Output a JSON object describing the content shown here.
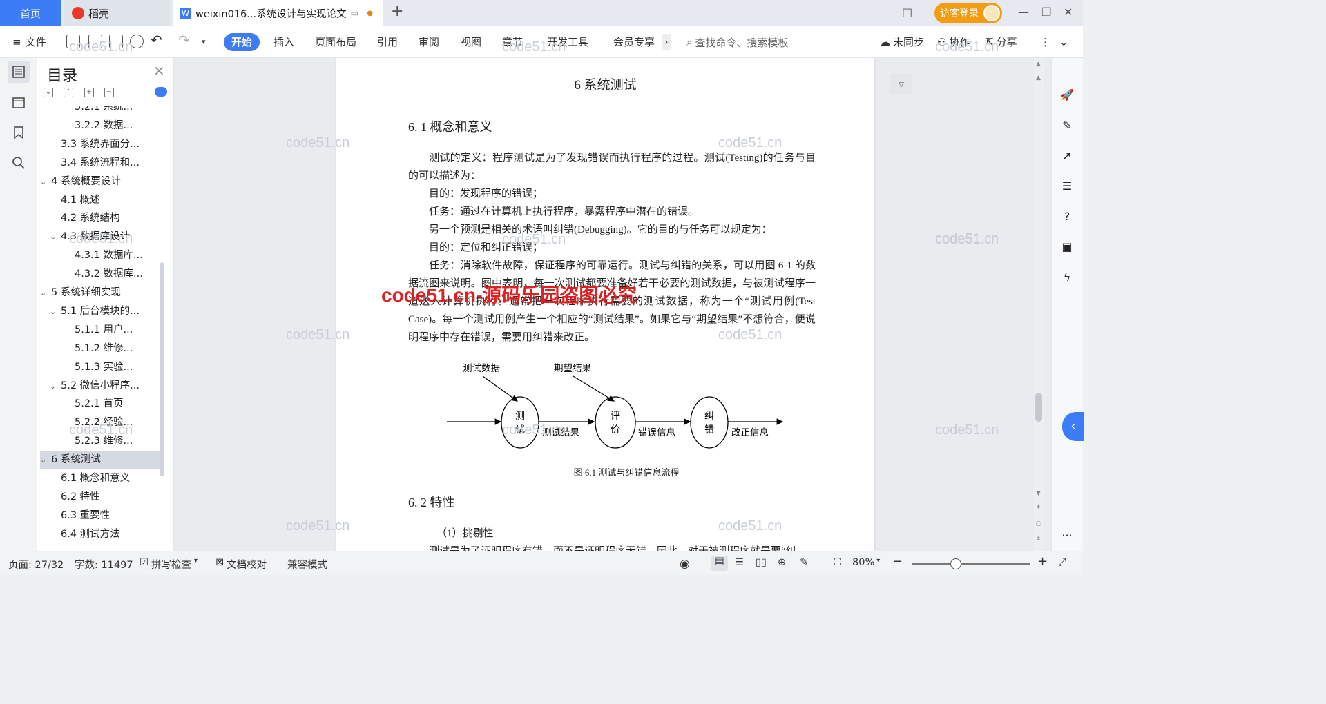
{
  "titlebar": {
    "home_tab": "首页",
    "daoke_tab": "稻壳",
    "doc_tab": "weixin016...系统设计与实现论文",
    "login": "访客登录"
  },
  "toolbar": {
    "file": "文件",
    "menus": [
      "开始",
      "插入",
      "页面布局",
      "引用",
      "审阅",
      "视图",
      "章节",
      "开发工具",
      "会员专享"
    ],
    "search_placeholder": "查找命令、搜索模板",
    "sync": "未同步",
    "collab": "协作",
    "share": "分享"
  },
  "toc": {
    "title": "目录",
    "items": [
      {
        "label": "3.2.1  系统...",
        "level": 3,
        "caret": ""
      },
      {
        "label": "3.2.2  数据...",
        "level": 3,
        "caret": ""
      },
      {
        "label": "3.3 系统界面分...",
        "level": 2,
        "caret": ""
      },
      {
        "label": "3.4 系统流程和...",
        "level": 2,
        "caret": ""
      },
      {
        "label": "4 系统概要设计",
        "level": 1,
        "caret": "v"
      },
      {
        "label": "4.1 概述",
        "level": 2,
        "caret": ""
      },
      {
        "label": "4.2 系统结构",
        "level": 2,
        "caret": ""
      },
      {
        "label": "4.3 数据库设计",
        "level": 2,
        "caret": "v"
      },
      {
        "label": "4.3.1 数据库...",
        "level": 3,
        "caret": ""
      },
      {
        "label": "4.3.2 数据库...",
        "level": 3,
        "caret": ""
      },
      {
        "label": "5 系统详细实现",
        "level": 1,
        "caret": "v"
      },
      {
        "label": "5.1  后台模块的...",
        "level": 2,
        "caret": "v"
      },
      {
        "label": "5.1.1  用户...",
        "level": 3,
        "caret": ""
      },
      {
        "label": "5.1.2  维修...",
        "level": 3,
        "caret": ""
      },
      {
        "label": "5.1.3  实验...",
        "level": 3,
        "caret": ""
      },
      {
        "label": "5.2  微信小程序...",
        "level": 2,
        "caret": "v"
      },
      {
        "label": "5.2.1  首页",
        "level": 3,
        "caret": ""
      },
      {
        "label": "5.2.2  经验...",
        "level": 3,
        "caret": ""
      },
      {
        "label": "5.2.3  维修...",
        "level": 3,
        "caret": ""
      },
      {
        "label": "6 系统测试",
        "level": 1,
        "caret": "v",
        "active": true
      },
      {
        "label": "6.1 概念和意义",
        "level": 2,
        "caret": ""
      },
      {
        "label": "6.2 特性",
        "level": 2,
        "caret": ""
      },
      {
        "label": "6.3 重要性",
        "level": 2,
        "caret": ""
      },
      {
        "label": "6.4 测试方法",
        "level": 2,
        "caret": ""
      }
    ]
  },
  "document": {
    "heading": "6 系统测试",
    "section1": "6. 1 概念和意义",
    "paragraphs": [
      "测试的定义：程序测试是为了发现错误而执行程序的过程。测试(Testing)的任务与目的可以描述为：",
      "目的：发现程序的错误；",
      "任务：通过在计算机上执行程序，暴露程序中潜在的错误。",
      "另一个预测是相关的术语叫纠错(Debugging)。它的目的与任务可以规定为：",
      "目的：定位和纠正错误；",
      "任务：消除软件故障，保证程序的可靠运行。测试与纠错的关系，可以用图 6-1 的数据流图来说明。图中表明，每一次测试都要准备好若干必要的测试数据，与被测试程序一道送入计算机执行。通常把一次程序执行需要的测试数据，称为一个“测试用例(Test Case)。每一个测试用例产生一个相应的“测试结果”。如果它与“期望结果”不想符合，便说明程序中存在错误，需要用纠错来改正。"
    ],
    "figure": {
      "in1": "测试数据",
      "in2": "期望结果",
      "node1": "测\n试",
      "node2": "评\n价",
      "node3": "纠\n错",
      "edge1": "测试结果",
      "edge2": "错误信息",
      "edge3": "改正信息",
      "caption": "图 6.1 测试与纠错信息流程"
    },
    "section2": "6. 2 特性",
    "sub1": "（1）挑剔性",
    "cut_line": "测试是为了证明程序有错，而不是证明程序无错。因此，对于被测程序就是要“纠"
  },
  "watermarks": {
    "small": "code51.cn",
    "big": "code51.cn-源码乐园盗图必究"
  },
  "statusbar": {
    "page": "页面: 27/32",
    "words": "字数: 11497",
    "spell": "拼写检查",
    "proof": "文档校对",
    "compat": "兼容模式",
    "zoom": "80%"
  },
  "colors": {
    "accent": "#3c7cf6",
    "login": "#f39c12",
    "watermark_red": "#e02020"
  }
}
